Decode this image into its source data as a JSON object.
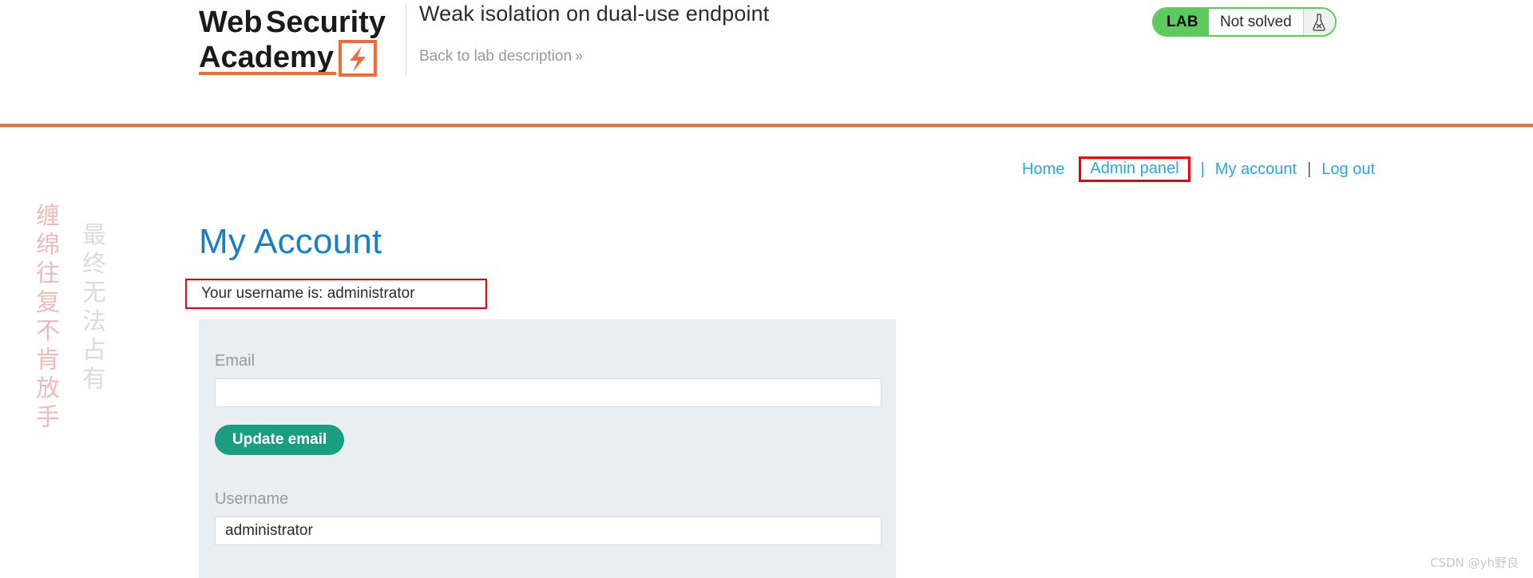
{
  "header": {
    "logo_line1": "Web Security",
    "logo_line2": "Academy",
    "lab_title": "Weak isolation on dual-use endpoint",
    "back_link": "Back to lab description",
    "back_link_chevron": "»",
    "lab_badge": {
      "tag": "LAB",
      "status": "Not solved",
      "icon": "flask-not-solved-icon"
    },
    "divider_color": "#f26a35"
  },
  "nav": {
    "items": [
      {
        "label": "Home",
        "highlighted": false
      },
      {
        "label": "Admin panel",
        "highlighted": true
      },
      {
        "label": "My account",
        "highlighted": false
      },
      {
        "label": "Log out",
        "highlighted": false
      }
    ],
    "separator": "|",
    "link_color": "#29a8e0",
    "highlight_color": "#e8000d"
  },
  "main": {
    "page_title": "My Account",
    "username_note": "Your username is: administrator",
    "email": {
      "label": "Email",
      "value": "",
      "button_label": "Update email"
    },
    "username": {
      "label": "Username",
      "value": "administrator"
    },
    "panel_color": "#e8eef1",
    "button_color": "#1a9e82",
    "title_color": "#1a80c4"
  },
  "watermarks": {
    "vertical_left": "缠绵往复不肯放手",
    "vertical_right": "最终无法占有",
    "corner": "CSDN @yh野良"
  }
}
